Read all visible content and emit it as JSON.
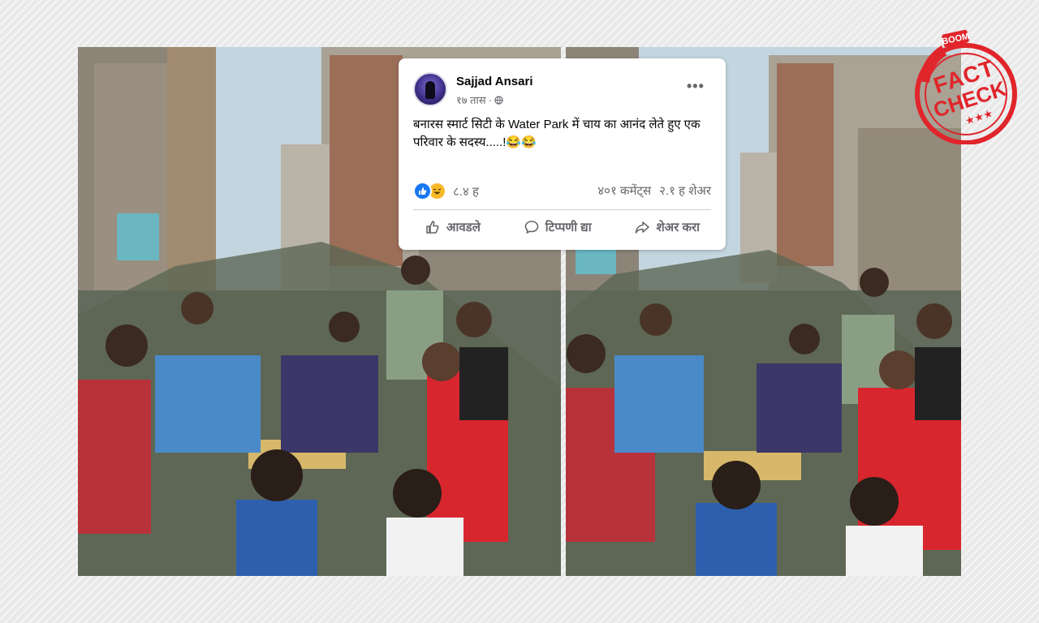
{
  "post": {
    "author": "Sajjad Ansari",
    "time": "१७ तास",
    "separator": "·",
    "privacy_icon": "globe-icon",
    "text": "बनारस स्मार्ट सिटी के Water Park में चाय का आनंद लेते हुए एक परिवार के सदस्य.....!😂😂",
    "more_icon": "more-options-icon",
    "more_label": "•••"
  },
  "reactions": {
    "icons": [
      "like-reaction-icon",
      "haha-reaction-icon"
    ],
    "count": "८.४ ह",
    "comments": "४०१ कमेंट्स",
    "shares": "२.१ ह शेअर"
  },
  "actions": {
    "like": "आवडले",
    "comment": "टिप्पणी द्या",
    "share": "शेअर करा"
  },
  "stamp": {
    "line1": "BOOM",
    "line2": "FACT",
    "line3": "CHECK",
    "stars": "★★★"
  },
  "colors": {
    "facebook_blue": "#1877f2",
    "haha_yellow": "#f7b928",
    "stamp_red": "#e0252b"
  }
}
